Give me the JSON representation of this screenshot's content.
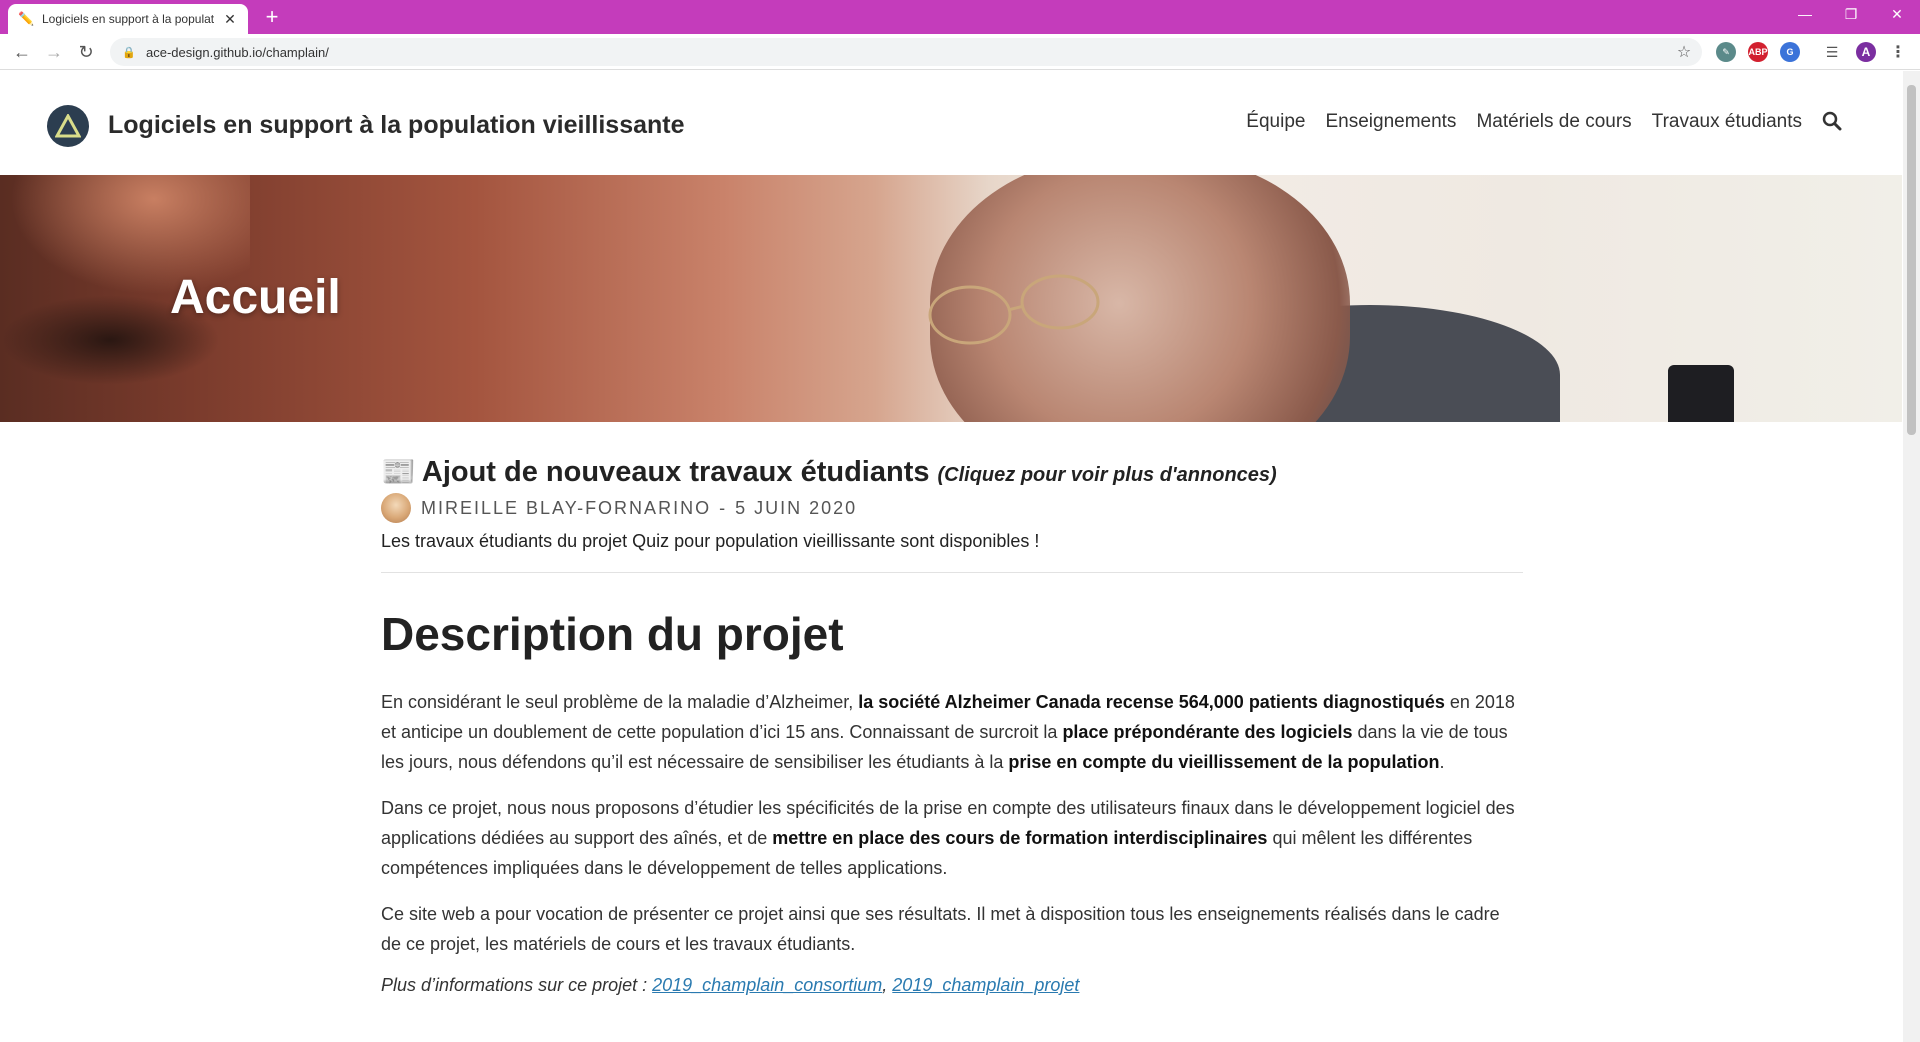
{
  "browser": {
    "tab_title": "Logiciels en support à la populat",
    "tab_favicon": "pencil-icon",
    "url": "ace-design.github.io/champlain/",
    "profile_initial": "A",
    "accent_color": "#c43cbb"
  },
  "site": {
    "title": "Logiciels en support à la population vieillissante",
    "nav": [
      "Équipe",
      "Enseignements",
      "Matériels de cours",
      "Travaux étudiants"
    ]
  },
  "hero": {
    "title": "Accueil"
  },
  "announcement": {
    "title": "Ajout de nouveaux travaux étudiants",
    "more": "(Cliquez pour voir plus d'annonces)",
    "author": "Mireille Blay-Fornarino",
    "date": "5 juin 2020",
    "separator": "-",
    "summary": "Les travaux étudiants du projet Quiz pour population vieillissante sont disponibles !"
  },
  "description": {
    "heading": "Description du projet",
    "p1": {
      "a": "En considérant le seul problème de la maladie d’Alzheimer, ",
      "b1": "la société Alzheimer Canada recense 564,000 patients diagnostiqués",
      "c": " en 2018 et anticipe un doublement de cette population d’ici 15 ans. Connaissant de surcroit la ",
      "b2": "place prépondérante des logiciels",
      "d": " dans la vie de tous les jours, nous défendons qu’il est nécessaire de sensibiliser les étudiants à la ",
      "b3": "prise en compte du vieillissement de la population",
      "e": "."
    },
    "p2": {
      "a": "Dans ce projet, nous nous proposons d’étudier les spécificités de la prise en compte des utilisateurs finaux dans le développement logiciel des applications dédiées au support des aînés, et de ",
      "b": "mettre en place des cours de formation interdisciplinaires",
      "c": " qui mêlent les différentes compétences impliquées dans le développement de telles applications."
    },
    "p3": "Ce site web a pour vocation de présenter ce projet ainsi que ses résultats. Il met à disposition tous les enseignements réalisés dans le cadre de ce projet, les matériels de cours et les travaux étudiants.",
    "more_label": "Plus d’informations sur ce projet : ",
    "more_links": [
      "2019_champlain_consortium",
      "2019_champlain_projet"
    ]
  }
}
